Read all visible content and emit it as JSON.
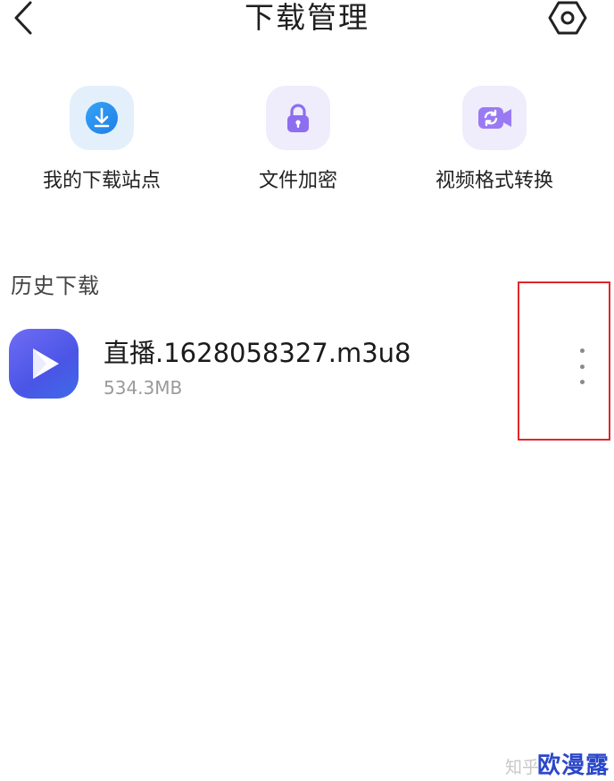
{
  "header": {
    "title": "下载管理"
  },
  "actions": [
    {
      "label": "我的下载站点",
      "icon": "download-icon"
    },
    {
      "label": "文件加密",
      "icon": "lock-icon"
    },
    {
      "label": "视频格式转换",
      "icon": "video-convert-icon"
    }
  ],
  "history": {
    "title": "历史下载",
    "items": [
      {
        "name": "直播.1628058327.m3u8",
        "size": "534.3MB",
        "icon": "video-player-icon"
      }
    ]
  },
  "colors": {
    "highlight": "#e0262b",
    "accent": "#4a55e6",
    "brand": "#2b47c9"
  },
  "watermark": {
    "source": "知乎",
    "brand": "欧漫露"
  }
}
